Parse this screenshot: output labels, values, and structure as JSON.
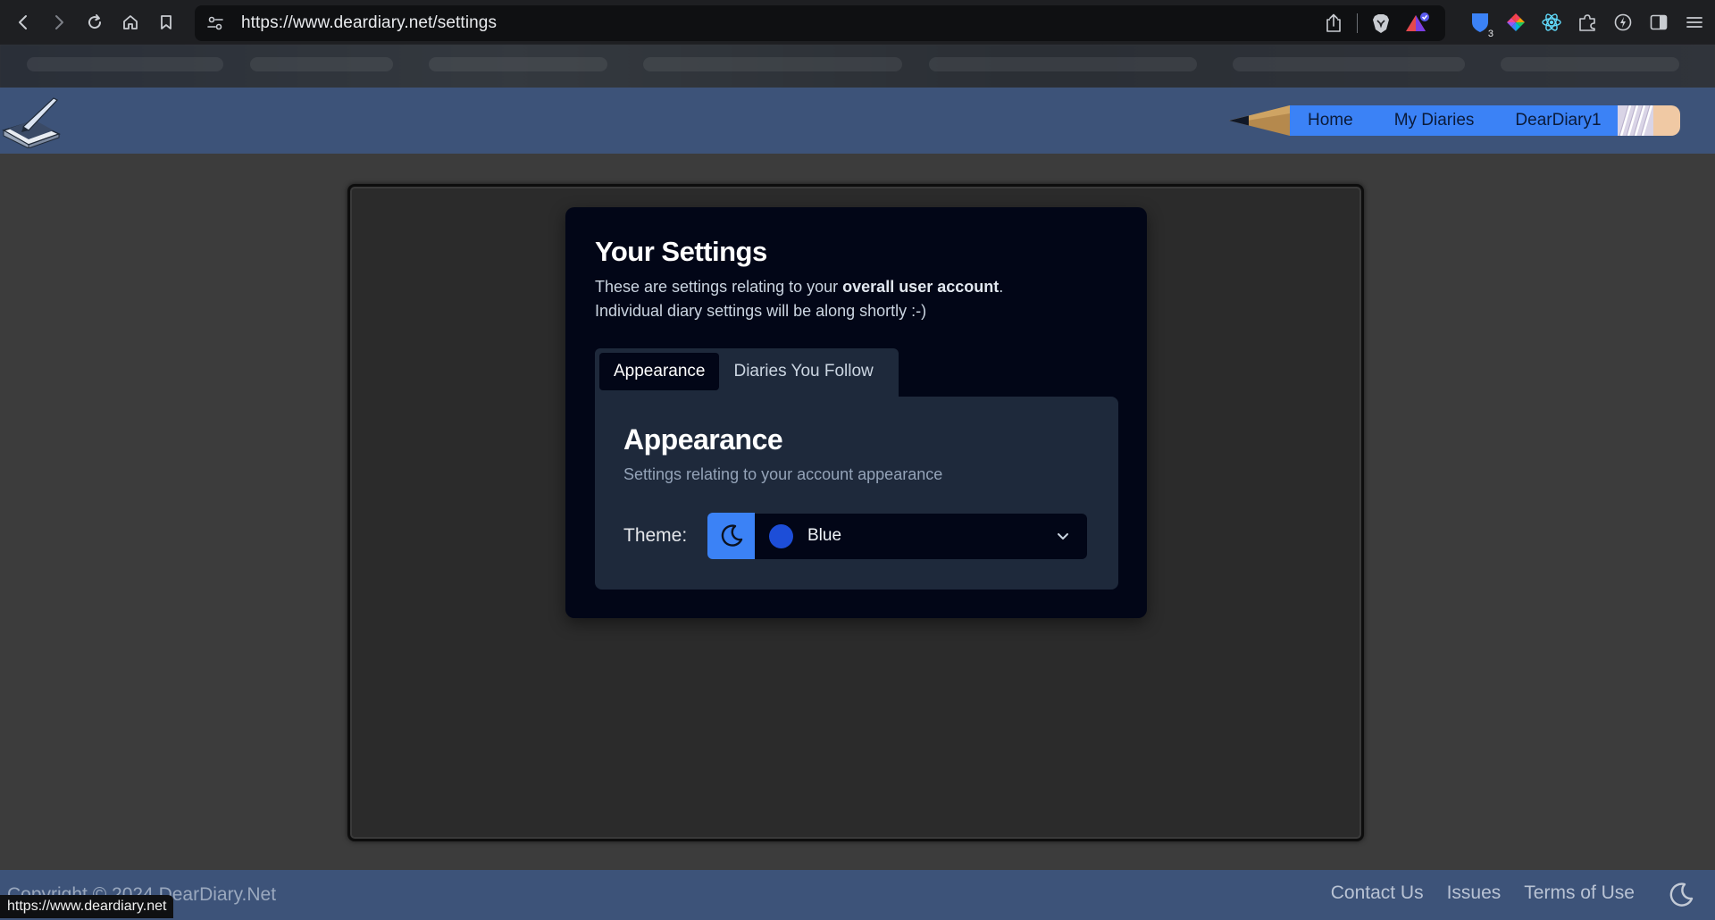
{
  "browser": {
    "url": "https://www.deardiary.net/settings",
    "status_url": "https://www.deardiary.net",
    "extension_badge_count": "3"
  },
  "header": {
    "nav": [
      "Home",
      "My Diaries",
      "DearDiary1"
    ]
  },
  "settings": {
    "title": "Your Settings",
    "desc_prefix": "These are settings relating to your ",
    "desc_bold": "overall user account",
    "desc_suffix": ".",
    "desc_line2": "Individual diary settings will be along shortly :-)",
    "tabs": [
      {
        "label": "Appearance",
        "active": true
      },
      {
        "label": "Diaries You Follow",
        "active": false
      }
    ],
    "panel": {
      "title": "Appearance",
      "description": "Settings relating to your account appearance",
      "theme_label": "Theme:",
      "theme_value": "Blue",
      "theme_color": "#1d4ed8",
      "theme_mode_icon": "moon-icon"
    }
  },
  "footer": {
    "copyright": "Copyright © 2024 DearDiary.Net",
    "links": [
      "Contact Us",
      "Issues",
      "Terms of Use"
    ]
  },
  "colors": {
    "accent": "#3b82f6",
    "header_bg": "#3d5379",
    "card_bg": "#020617",
    "panel_bg": "#1e293b"
  }
}
